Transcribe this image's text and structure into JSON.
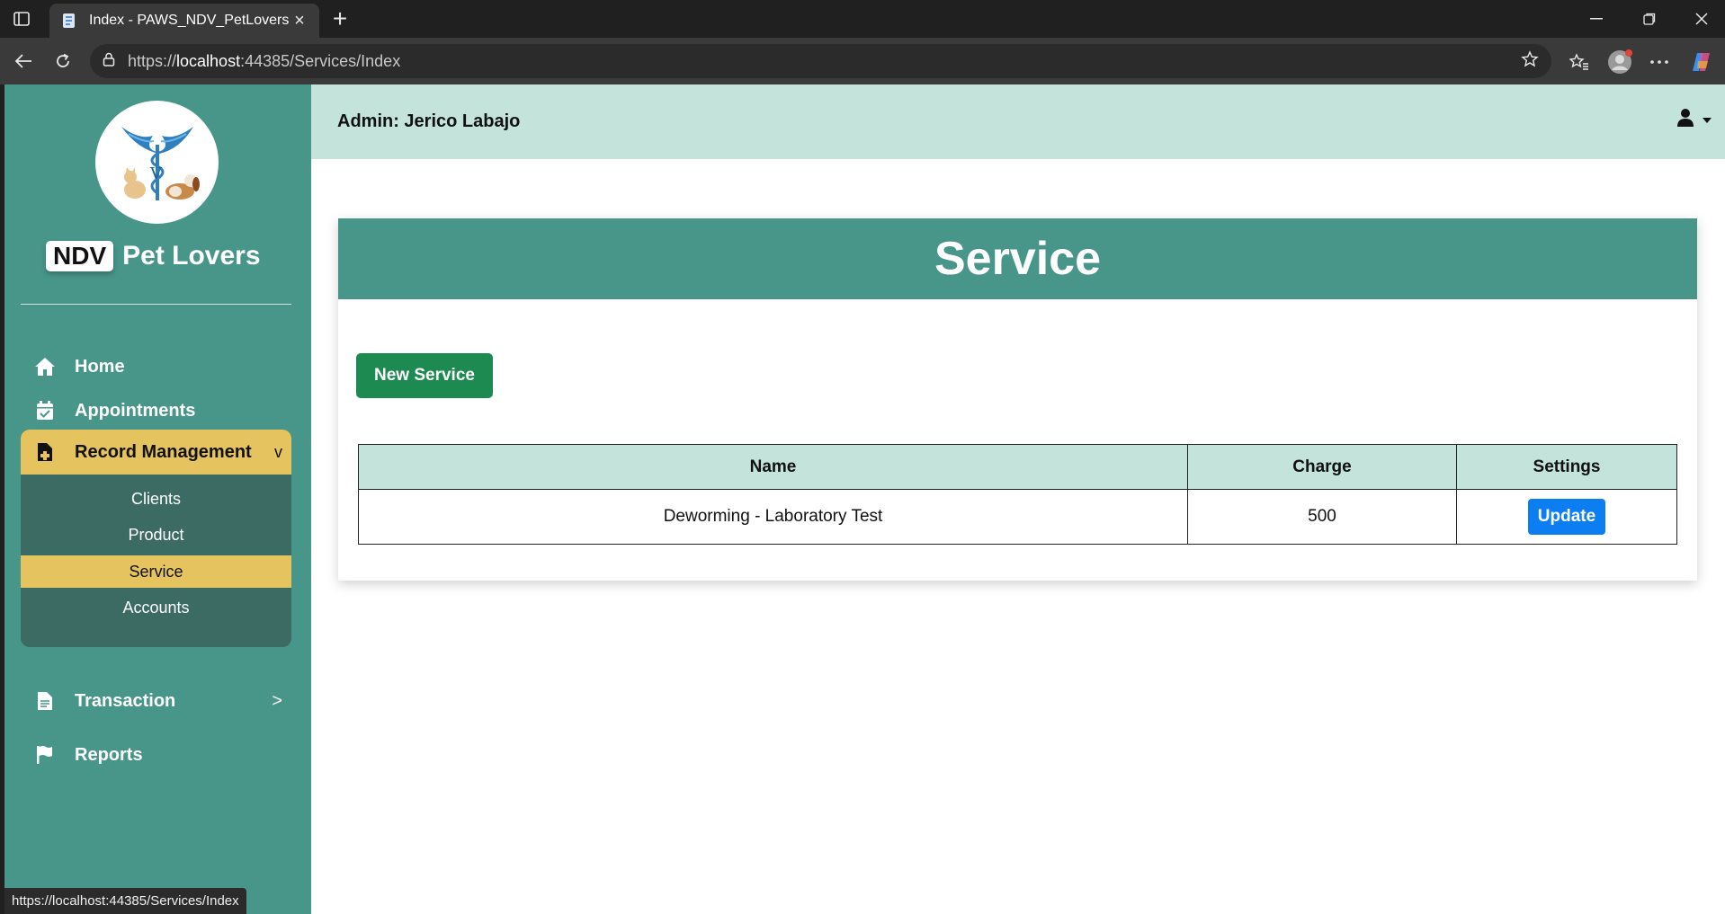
{
  "browser": {
    "tab_title": "Index - PAWS_NDV_PetLovers",
    "url_scheme": "https://",
    "url_host": "localhost",
    "url_rest": ":44385/Services/Index",
    "status_url": "https://localhost:44385/Services/Index"
  },
  "sidebar": {
    "brand_badge": "NDV",
    "brand_name": "Pet Lovers",
    "items": [
      {
        "label": "Home",
        "icon": "home-icon"
      },
      {
        "label": "Appointments",
        "icon": "calendar-check-icon"
      },
      {
        "label": "Record Management",
        "icon": "file-medical-icon",
        "arrow": "v"
      },
      {
        "label": "Transaction",
        "icon": "file-text-icon",
        "arrow": ">"
      },
      {
        "label": "Reports",
        "icon": "flag-icon"
      }
    ],
    "sub_items": [
      "Clients",
      "Product",
      "Service",
      "Accounts"
    ],
    "active_sub_item": "Service"
  },
  "header": {
    "admin_label": "Admin: Jerico Labajo"
  },
  "main": {
    "title": "Service",
    "new_button": "New Service",
    "columns": [
      "Name",
      "Charge",
      "Settings"
    ],
    "rows": [
      {
        "name": "Deworming - Laboratory Test",
        "charge": "500",
        "action": "Update"
      }
    ]
  },
  "colors": {
    "sidebar": "#48958a",
    "accent_yellow": "#e5c35f",
    "header_bg": "#c4e3da",
    "primary_green": "#1d8a52",
    "update_blue": "#0d7ef2"
  }
}
